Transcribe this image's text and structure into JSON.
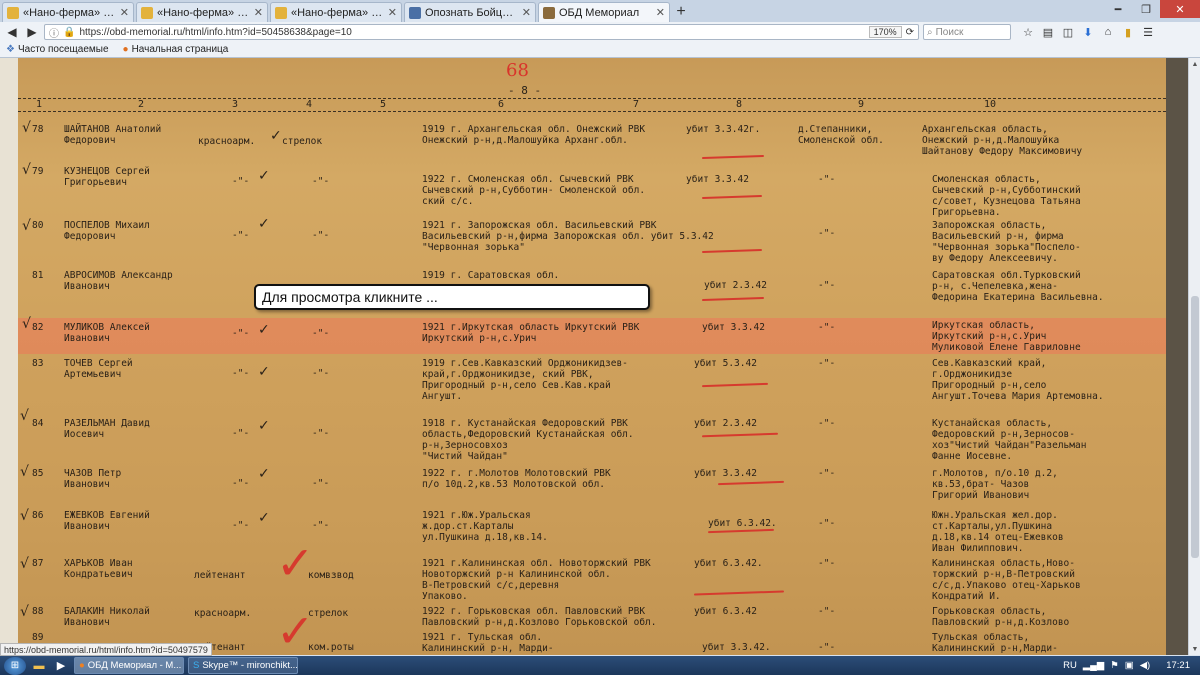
{
  "browser": {
    "tabs": [
      {
        "title": "«Нано-ферма» - Приложен",
        "active": false
      },
      {
        "title": "«Нано-ферма» - Приложен",
        "active": false
      },
      {
        "title": "«Нано-ферма» - Приложен",
        "active": false
      },
      {
        "title": "Опознать Бойца! | Страниц",
        "active": false
      },
      {
        "title": "ОБД Мемориал",
        "active": true
      }
    ],
    "new_tab_label": "+",
    "url": "https://obd-memorial.ru/html/info.htm?id=50458638&page=10",
    "zoom": "170%",
    "search_placeholder": "Поиск",
    "bookmarks": [
      "Часто посещаемые",
      "Начальная страница"
    ]
  },
  "document": {
    "page_number": "68",
    "top_marker": "- 8 -",
    "column_headers": [
      "1",
      "2",
      "3",
      "4",
      "5",
      "6",
      "7",
      "8",
      "9",
      "10"
    ],
    "rows": [
      {
        "n": "78",
        "name": "ШАЙТАНОВ Анатолий\nФедорович",
        "rank": "красноарм.",
        "pos": "стрелок",
        "birth": "1919 г. Архангельская обл. Онежский РВК\nОнежский р-н,д.Малошуйка Арханг.обл.",
        "fate": "убит 3.3.42г.",
        "burial": "д.Степанники,\nСмоленской обл.",
        "kin": "Архангельская область,\nОнежский р-н,д.Малошуйка\nШайтанову Федору Максимовичу"
      },
      {
        "n": "79",
        "name": "КУЗНЕЦОВ Сергей\nГригорьевич",
        "rank": "-\"-",
        "pos": "-\"-",
        "birth": "1922 г. Смоленская обл. Сычевский РВК\nСычевский р-н,Субботин- Смоленской обл.\nский с/с.",
        "fate": "убит 3.3.42",
        "burial": "-\"-",
        "kin": "Смоленская область,\nСычевский р-н,Субботинский\nс/совет, Кузнецова Татьяна\nГригорьевна."
      },
      {
        "n": "80",
        "name": "ПОСПЕЛОВ Михаил\nФедорович",
        "rank": "-\"-",
        "pos": "-\"-",
        "birth": "1921 г. Запорожская обл. Васильевский РВК\nВасильевский р-н,фирма Запорожская обл. убит 5.3.42\n\"Червонная зорька\"",
        "fate": "",
        "burial": "-\"-",
        "kin": "Запорожская область,\nВасильевский р-н, фирма\n\"Червонная зорька\"Поспело-\nву Федору Алексеевичу."
      },
      {
        "n": "81",
        "name": "АВРОСИМОВ Александр\nИванович",
        "rank": "",
        "pos": "",
        "birth": "1919 г. Саратовская обл.",
        "fate": "убит 2.3.42",
        "burial": "-\"-",
        "kin": "Саратовская обл.Турковский\nр-н, с.Чепелевка,жена-\nФедорина Екатерина Васильевна."
      },
      {
        "n": "82",
        "name": "МУЛИКОВ Алексей\nИванович",
        "rank": "-\"-",
        "pos": "-\"-",
        "birth": "1921 г.Иркутская область Иркутский РВК\nИркутский р-н,с.Урич",
        "fate": "убит 3.3.42",
        "burial": "-\"-",
        "kin": "Иркутская область,\nИркутский р-н,с.Урич\nМуликовой Елене Гавриловне"
      },
      {
        "n": "83",
        "name": "ТОЧЕВ Сергей\nАртемьевич",
        "rank": "-\"-",
        "pos": "-\"-",
        "birth": "1919 г.Сев.Кавказский Орджоникидзев-\nкрай,г.Орджоникидзе, ский РВК,\nПригородный р-н,село Сев.Кав.край\nАнгушт.",
        "fate": "убит 5.3.42",
        "burial": "-\"-",
        "kin": "Сев.Кавказский край,\nг.Орджоникидзе\nПригородный р-н,село\nАнгушт.Точева Мария Артемовна."
      },
      {
        "n": "84",
        "name": "РАЗЕЛЬМАН Давид\nИосевич",
        "rank": "-\"-",
        "pos": "-\"-",
        "birth": "1918 г. Кустанайская Федоровский РВК\nобласть,Федоровский Кустанайская обл.\nр-н,Зерносовхоз\n\"Чистий Чайдан\"",
        "fate": "убит 2.3.42",
        "burial": "-\"-",
        "kin": "Кустанайская область,\nФедоровский р-н,Зерносов-\nхоз\"Чистий Чайдан\"Разельман\nФанне Иосевне."
      },
      {
        "n": "85",
        "name": "ЧАЗОВ Петр\nИванович",
        "rank": "-\"-",
        "pos": "-\"-",
        "birth": "1922 г. г.Молотов Молотовский РВК\nп/о 10д.2,кв.53 Молотовской обл.",
        "fate": "убит 3.3.42",
        "burial": "-\"-",
        "kin": "г.Молотов, п/о.10 д.2,\nкв.53,брат- Чазов\nГригорий Иванович"
      },
      {
        "n": "86",
        "name": "ЕЖЕВКОВ Евгений\nИванович",
        "rank": "-\"-",
        "pos": "-\"-",
        "birth": "1921 г.Юж.Уральская\nж.дор.ст.Карталы\nул.Пушкина д.18,кв.14.",
        "fate": "убит 6.3.42.",
        "burial": "-\"-",
        "kin": "Южн.Уральская жел.дор.\nст.Карталы,ул.Пушкина\nд.18,кв.14 отец-Ежевков\nИван Филиппович."
      },
      {
        "n": "87",
        "name": "ХАРЬКОВ Иван\nКондратьевич",
        "rank": "лейтенант",
        "pos": "комвзвод",
        "birth": "1921 г.Калининская обл. Новоторжский РВК\nНовоторжский р-н Калининской обл.\nВ-Петровский с/с,деревня\nУпаково.",
        "fate": "убит 6.3.42.",
        "burial": "-\"-",
        "kin": "Калининская область,Ново-\nторжский р-н,В-Петровский\nс/с,д.Упаково отец-Харьков\nКондратий И."
      },
      {
        "n": "88",
        "name": "БАЛАКИН Николай\nИванович",
        "rank": "красноарм.",
        "pos": "стрелок",
        "birth": "1922 г. Горьковская обл. Павловский РВК\nПавловский р-н,д.Козлово Горьковской обл.",
        "fate": "убит 6.3.42",
        "burial": "-\"-",
        "kin": "Горьковская область,\nПавловский р-н,д.Козлово"
      },
      {
        "n": "89",
        "name": "",
        "rank": "лейтенант",
        "pos": "ком.роты",
        "birth": "1921 г. Тульская обл.\nКалининский р-н, Марди-",
        "fate": "убит 3.3.42.",
        "burial": "-\"-",
        "kin": "Тульская область,\nКалининский р-н,Марди-\nс/с,д."
      }
    ],
    "tooltip": "Для просмотра кликните ..."
  },
  "status_url": "https://obd-memorial.ru/html/info.htm?id=50497579",
  "taskbar": {
    "tasks": [
      {
        "title": "ОБД Мемориал - M...",
        "active": true
      },
      {
        "title": "Skype™ - mironchikt...",
        "active": false
      }
    ],
    "language": "RU",
    "time": "17:21"
  }
}
